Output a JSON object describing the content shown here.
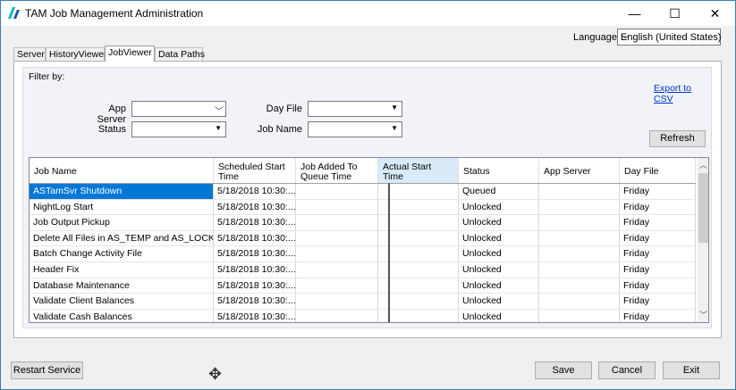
{
  "window": {
    "title": "TAM Job Management Administration",
    "minimize_glyph": "—",
    "maximize_glyph": "☐",
    "close_glyph": "✕"
  },
  "language": {
    "label": "Language",
    "value": "English (United States)"
  },
  "tabs": [
    {
      "label": "Server"
    },
    {
      "label": "HistoryViewer"
    },
    {
      "label": "JobViewer"
    },
    {
      "label": "Data Paths"
    }
  ],
  "filter": {
    "label": "Filter by:",
    "export_link": "Export to CSV",
    "app_server_label": "App Server",
    "app_server_value": "",
    "day_file_label": "Day File",
    "day_file_value": "",
    "status_label": "Status",
    "status_value": "",
    "job_name_label": "Job Name",
    "job_name_value": "",
    "refresh_label": "Refresh"
  },
  "grid": {
    "columns": [
      "Job Name",
      "Scheduled Start Time",
      "Job Added To Queue Time",
      "Actual Start Time",
      "Status",
      "App Server",
      "Day File"
    ],
    "rows": [
      {
        "job": "ASTamSvr Shutdown",
        "sched": "5/18/2018 10:30:...",
        "added": "",
        "actual": "",
        "status": "Queued",
        "server": "",
        "day": "Friday"
      },
      {
        "job": "NightLog Start",
        "sched": "5/18/2018 10:30:...",
        "added": "",
        "actual": "",
        "status": "Unlocked",
        "server": "",
        "day": "Friday"
      },
      {
        "job": "Job Output Pickup",
        "sched": "5/18/2018 10:30:...",
        "added": "",
        "actual": "",
        "status": "Unlocked",
        "server": "",
        "day": "Friday"
      },
      {
        "job": "Delete All Files in AS_TEMP and AS_LOCK",
        "sched": "5/18/2018 10:30:...",
        "added": "",
        "actual": "",
        "status": "Unlocked",
        "server": "",
        "day": "Friday"
      },
      {
        "job": "Batch Change Activity File",
        "sched": "5/18/2018 10:30:...",
        "added": "",
        "actual": "",
        "status": "Unlocked",
        "server": "",
        "day": "Friday"
      },
      {
        "job": "Header Fix",
        "sched": "5/18/2018 10:30:...",
        "added": "",
        "actual": "",
        "status": "Unlocked",
        "server": "",
        "day": "Friday"
      },
      {
        "job": "Database Maintenance",
        "sched": "5/18/2018 10:30:...",
        "added": "",
        "actual": "",
        "status": "Unlocked",
        "server": "",
        "day": "Friday"
      },
      {
        "job": "Validate Client Balances",
        "sched": "5/18/2018 10:30:...",
        "added": "",
        "actual": "",
        "status": "Unlocked",
        "server": "",
        "day": "Friday"
      },
      {
        "job": "Validate Cash Balances",
        "sched": "5/18/2018 10:30:...",
        "added": "",
        "actual": "",
        "status": "Unlocked",
        "server": "",
        "day": "Friday"
      }
    ]
  },
  "buttons": {
    "restart": "Restart Service",
    "save": "Save",
    "cancel": "Cancel",
    "exit": "Exit"
  },
  "colors": {
    "selection": "#0078d7",
    "title_accent": "#00b4c8",
    "link": "#0033cc"
  }
}
